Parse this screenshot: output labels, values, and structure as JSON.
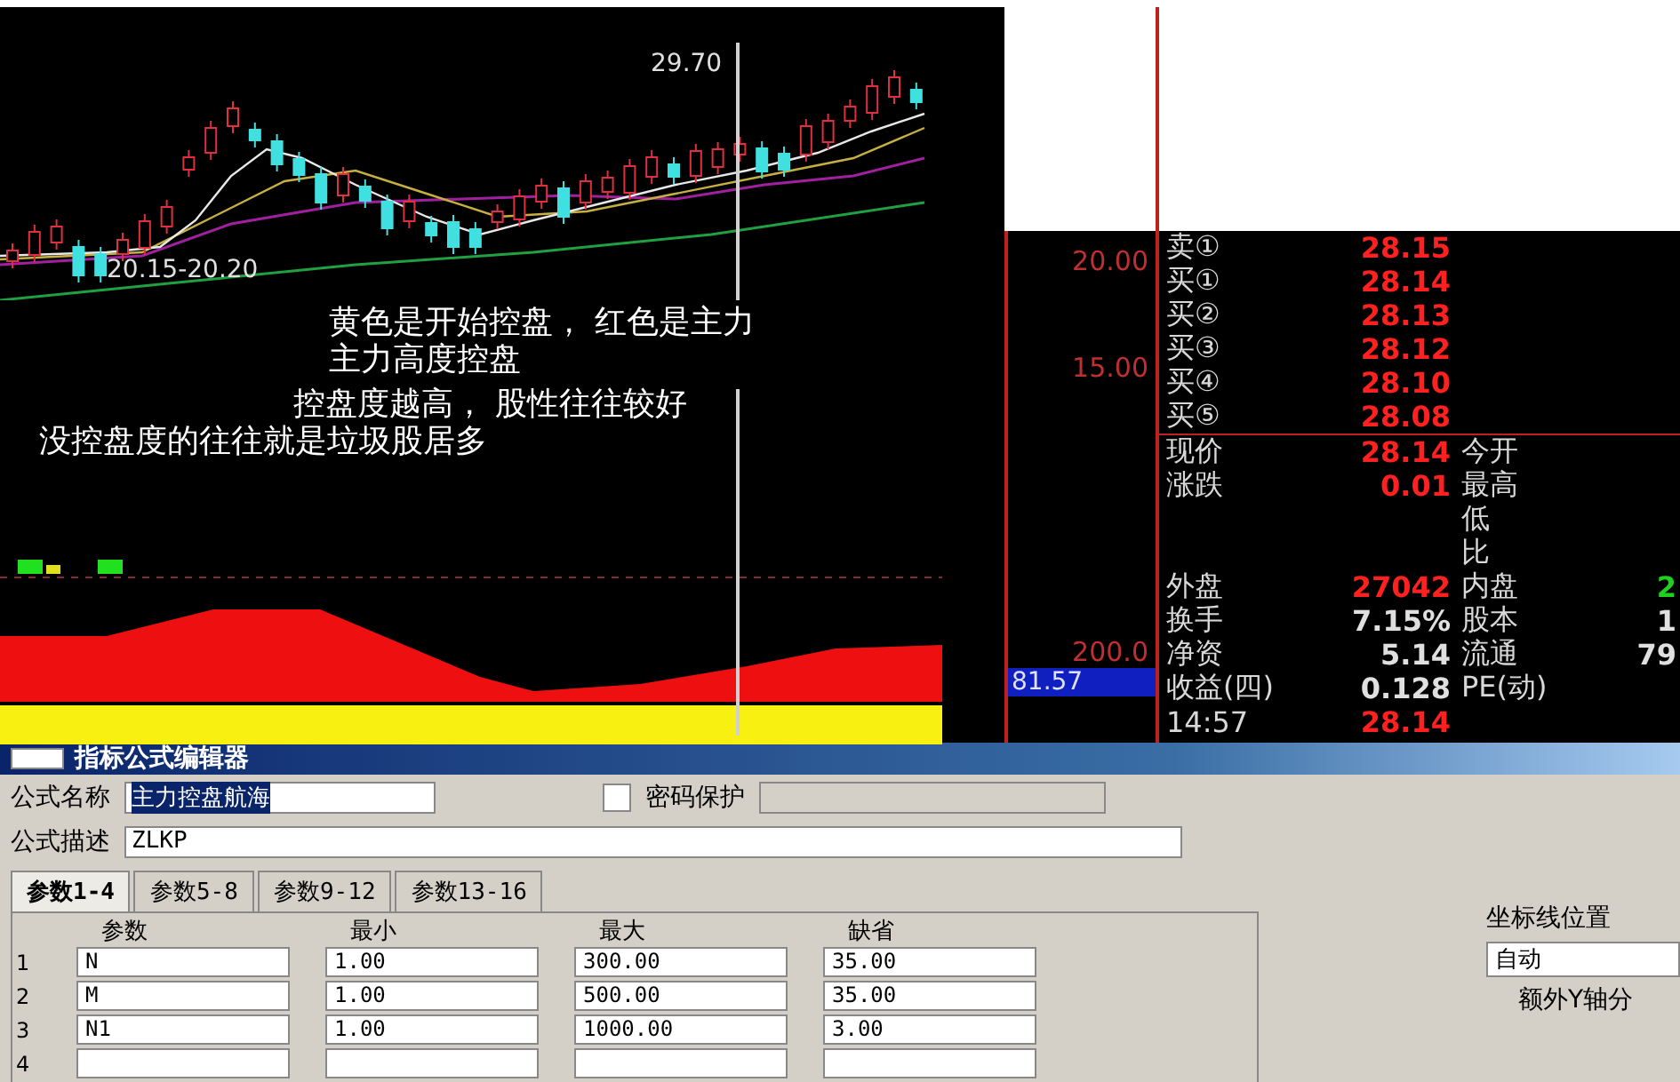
{
  "chart": {
    "price_labels": [
      {
        "text": "29.70"
      },
      {
        "text": "20.15-20.20"
      }
    ],
    "annotations": [
      "黄色是开始控盘， 红色是主力",
      "主力高度控盘",
      "控盘度越高， 股性往往较好",
      "没控盘度的往往就是垃圾股居多"
    ],
    "axis_labels": [
      "20.00",
      "15.00"
    ],
    "indicator_axis": {
      "label": "200.0",
      "current": "81.57"
    }
  },
  "quote": {
    "book": [
      {
        "label": "卖①",
        "price": "28.15"
      },
      {
        "label": "买①",
        "price": "28.14"
      },
      {
        "label": "买②",
        "price": "28.13"
      },
      {
        "label": "买③",
        "price": "28.12"
      },
      {
        "label": "买④",
        "price": "28.10"
      },
      {
        "label": "买⑤",
        "price": "28.08"
      }
    ],
    "stats": [
      {
        "left": {
          "label": "现价",
          "value": "28.14",
          "color": "#ff2020"
        },
        "right": {
          "label": "今开"
        }
      },
      {
        "left": {
          "label": "涨跌",
          "value": "0.01",
          "color": "#ff2020"
        },
        "right": {
          "label": "最高"
        }
      },
      {
        "right": {
          "label": "低"
        }
      },
      {
        "right": {
          "label": "比"
        }
      },
      {
        "left": {
          "label": "外盘",
          "value": "27042",
          "color": "#ff2020"
        },
        "right": {
          "label": "内盘",
          "value": "2",
          "color": "#20d020"
        }
      },
      {
        "left": {
          "label": "换手",
          "value": "7.15%",
          "color": "#e0e0e0"
        },
        "right": {
          "label": "股本",
          "value": "1",
          "color": "#e0e0e0"
        }
      },
      {
        "left": {
          "label": "净资",
          "value": "5.14",
          "color": "#e0e0e0"
        },
        "right": {
          "label": "流通",
          "value": "79",
          "color": "#e0e0e0"
        }
      },
      {
        "left": {
          "label": "收益(四)",
          "value": "0.128",
          "color": "#e0e0e0"
        },
        "right": {
          "label": "PE(动)"
        }
      },
      {
        "left": {
          "label": "14:57",
          "value": "28.14",
          "color": "#ff2020"
        }
      }
    ]
  },
  "editor": {
    "title": "指标公式编辑器",
    "name_label": "公式名称",
    "name_value": "主力控盘航海",
    "password": {
      "label": "密码保护",
      "checked": false
    },
    "desc_label": "公式描述",
    "desc_value": "ZLKP",
    "tabs": [
      {
        "label": "参数1-4",
        "selected": true
      },
      {
        "label": "参数5-8",
        "selected": false
      },
      {
        "label": "参数9-12",
        "selected": false
      },
      {
        "label": "参数13-16",
        "selected": false
      }
    ],
    "params": {
      "columns": [
        "参数",
        "最小",
        "最大",
        "缺省"
      ],
      "rows": [
        {
          "index": "1",
          "cells": [
            "N",
            "1.00",
            "300.00",
            "35.00"
          ]
        },
        {
          "index": "2",
          "cells": [
            "M",
            "1.00",
            "500.00",
            "35.00"
          ]
        },
        {
          "index": "3",
          "cells": [
            "N1",
            "1.00",
            "1000.00",
            "3.00"
          ]
        },
        {
          "index": "4"
        }
      ]
    },
    "axis_position": {
      "label": "坐标线位置",
      "value": "自动"
    },
    "extra_y_label": "额外Y轴分"
  }
}
